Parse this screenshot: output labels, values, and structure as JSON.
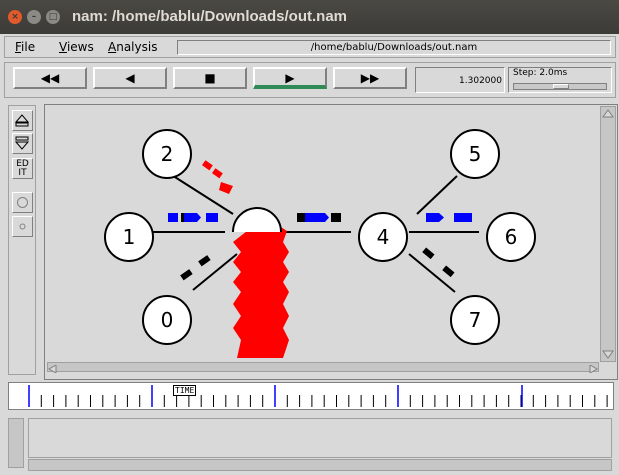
{
  "window": {
    "title": "nam: /home/bablu/Downloads/out.nam",
    "close_glyph": "×",
    "min_glyph": "–",
    "max_glyph": "□"
  },
  "menu": {
    "file": "File",
    "views": "Views",
    "analysis": "Analysis",
    "path": "/home/bablu/Downloads/out.nam"
  },
  "transport": {
    "rewind": "◀◀",
    "back": "◀",
    "stop": "■",
    "play": "▶",
    "forward": "▶▶",
    "time": "1.302000",
    "step": "Step: 2.0ms",
    "step_fraction": 0.5
  },
  "tools": {
    "edit": "ED\nIT"
  },
  "nodes": [
    {
      "id": "0",
      "label": "0"
    },
    {
      "id": "1",
      "label": "1"
    },
    {
      "id": "2",
      "label": "2"
    },
    {
      "id": "3",
      "label": ""
    },
    {
      "id": "4",
      "label": "4"
    },
    {
      "id": "5",
      "label": "5"
    },
    {
      "id": "6",
      "label": "6"
    },
    {
      "id": "7",
      "label": "7"
    }
  ],
  "timeline": {
    "label": "TIME"
  },
  "colors": {
    "packet_blue": "#0000ff",
    "packet_red": "#ff0000",
    "packet_black": "#000000",
    "play_active": "#2e8b57"
  }
}
